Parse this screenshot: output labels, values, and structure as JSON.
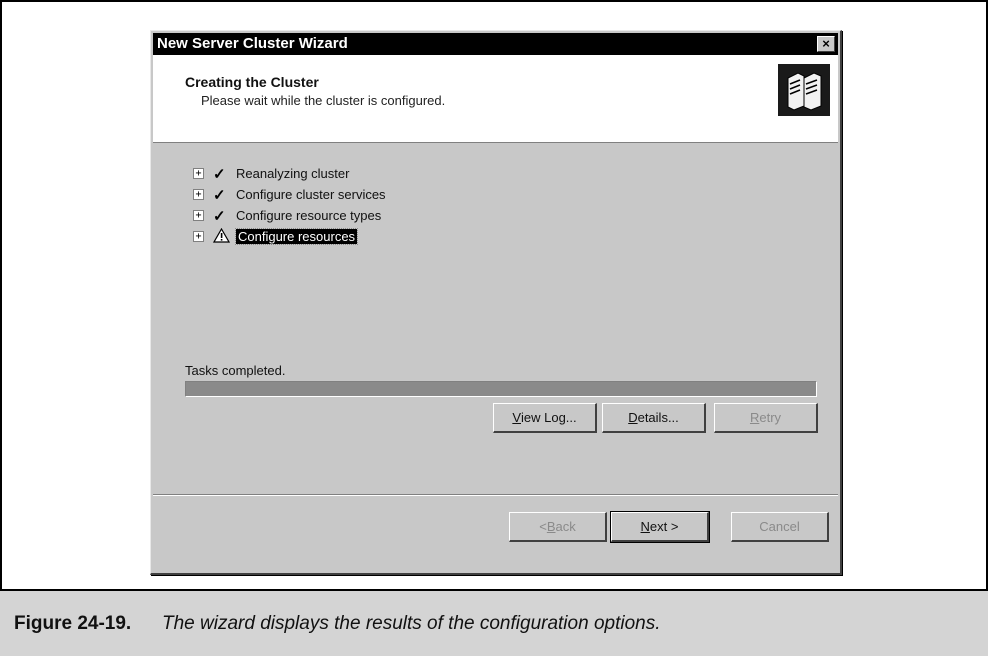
{
  "window": {
    "title": "New Server Cluster Wizard",
    "close_glyph": "×"
  },
  "header": {
    "title": "Creating the Cluster",
    "subtitle": "Please wait while the cluster is configured.",
    "icon": "server-cluster-icon"
  },
  "tasks": [
    {
      "label": "Reanalyzing cluster",
      "status": "check-icon",
      "expander": "+"
    },
    {
      "label": "Configure cluster services",
      "status": "check-icon",
      "expander": "+"
    },
    {
      "label": "Configure resource types",
      "status": "check-icon",
      "expander": "+"
    },
    {
      "label": "Configure resources",
      "status": "warning-icon",
      "expander": "+",
      "selected": true
    }
  ],
  "status": {
    "label": "Tasks completed.",
    "progress": 1.0
  },
  "action_buttons": {
    "view_log": {
      "prefix": "",
      "mnemonic": "V",
      "rest": "iew Log..."
    },
    "details": {
      "prefix": "",
      "mnemonic": "D",
      "rest": "etails..."
    },
    "retry": {
      "prefix": "",
      "mnemonic": "R",
      "rest": "etry"
    }
  },
  "nav_buttons": {
    "back": {
      "prefix": "< ",
      "mnemonic": "B",
      "rest": "ack"
    },
    "next": {
      "prefix": "",
      "mnemonic": "N",
      "rest": "ext >"
    },
    "cancel": {
      "label": "Cancel"
    }
  },
  "caption": {
    "number": "Figure 24-19.",
    "text": "The wizard displays the results of the configuration options."
  },
  "colors": {
    "dialog_face": "#c8c8c8",
    "titlebar": "#000000",
    "progress_fill": "#8a8a8a"
  }
}
